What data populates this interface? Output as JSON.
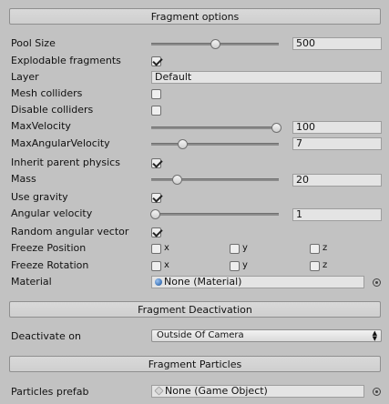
{
  "fragment_options": {
    "header": "Fragment options",
    "pool_size": {
      "label": "Pool Size",
      "value": "500",
      "slider": 0.5
    },
    "explodable_fragments": {
      "label": "Explodable fragments",
      "checked": true
    },
    "layer": {
      "label": "Layer",
      "value": "Default"
    },
    "mesh_colliders": {
      "label": "Mesh colliders",
      "checked": false
    },
    "disable_colliders": {
      "label": "Disable colliders",
      "checked": false
    },
    "max_velocity": {
      "label": "MaxVelocity",
      "value": "100",
      "slider": 1.0
    },
    "max_angular_velocity": {
      "label": "MaxAngularVelocity",
      "value": "7",
      "slider": 0.25
    },
    "inherit_parent_physics": {
      "label": "Inherit parent physics",
      "checked": true
    },
    "mass": {
      "label": "Mass",
      "value": "20",
      "slider": 0.2
    },
    "use_gravity": {
      "label": "Use gravity",
      "checked": true
    },
    "angular_velocity": {
      "label": "Angular velocity",
      "value": "1",
      "slider": 0.02
    },
    "random_angular_vector": {
      "label": "Random angular vector",
      "checked": true
    },
    "freeze_position": {
      "label": "Freeze Position",
      "x": "x",
      "y": "y",
      "z": "z"
    },
    "freeze_rotation": {
      "label": "Freeze Rotation",
      "x": "x",
      "y": "y",
      "z": "z"
    },
    "material": {
      "label": "Material",
      "value": "None (Material)",
      "icon": "material-sphere-icon"
    }
  },
  "fragment_deactivation": {
    "header": "Fragment Deactivation",
    "deactivate_on": {
      "label": "Deactivate on",
      "value": "Outside Of Camera"
    }
  },
  "fragment_particles": {
    "header": "Fragment Particles",
    "particles_prefab": {
      "label": "Particles prefab",
      "value": "None (Game Object)",
      "icon": "game-object-icon"
    }
  },
  "colors": {
    "background": "#c2c2c2",
    "field": "#e4e4e4",
    "material_icon": "#4a7fc1"
  }
}
